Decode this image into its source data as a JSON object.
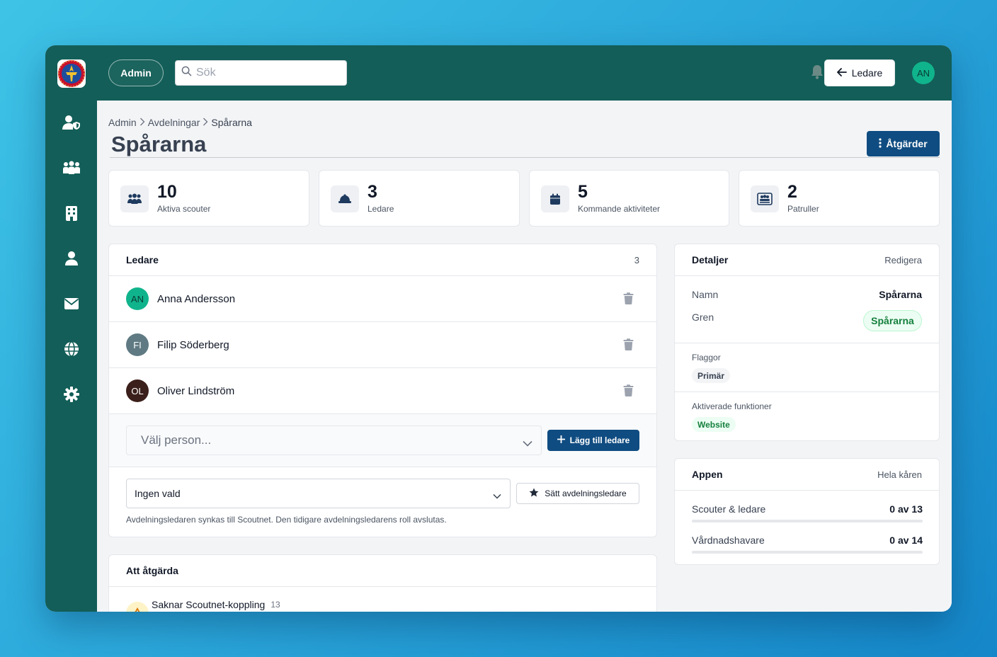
{
  "topbar": {
    "admin_label": "Admin",
    "search_placeholder": "Sök",
    "ledare_button": "Ledare",
    "user_initials": "AN"
  },
  "sidebar": {
    "items": [
      {
        "icon": "user-shield-icon"
      },
      {
        "icon": "people-group-icon"
      },
      {
        "icon": "building-icon"
      },
      {
        "icon": "user-icon"
      },
      {
        "icon": "envelope-icon"
      },
      {
        "icon": "globe-icon"
      },
      {
        "icon": "gear-icon"
      }
    ]
  },
  "breadcrumb": [
    "Admin",
    "Avdelningar",
    "Spårarna"
  ],
  "page": {
    "title": "Spårarna",
    "actions_button": "Åtgärder"
  },
  "stats": [
    {
      "value": "10",
      "label": "Aktiva scouter",
      "icon": "people-icon"
    },
    {
      "value": "3",
      "label": "Ledare",
      "icon": "hardhat-icon"
    },
    {
      "value": "5",
      "label": "Kommande aktiviteter",
      "icon": "calendar-icon"
    },
    {
      "value": "2",
      "label": "Patruller",
      "icon": "patrol-group-icon"
    }
  ],
  "leaders_card": {
    "title": "Ledare",
    "count": "3",
    "leaders": [
      {
        "initials": "AN",
        "name": "Anna Andersson",
        "color": "#10b48c"
      },
      {
        "initials": "FI",
        "name": "Filip Söderberg",
        "color": "#5f7a83"
      },
      {
        "initials": "OL",
        "name": "Oliver Lindström",
        "color": "#3b1f1a"
      }
    ],
    "person_select_placeholder": "Välj person...",
    "add_button": "Lägg till ledare",
    "section_leader_select": "Ingen vald",
    "set_section_leader_button": "Sätt avdelningsledare",
    "sync_note": "Avdelningsledaren synkas till Scoutnet. Den tidigare avdelningsledarens roll avslutas."
  },
  "todo_card": {
    "title": "Att åtgärda",
    "items": [
      {
        "label": "Saknar Scoutnet-koppling",
        "count": "13"
      }
    ]
  },
  "details_card": {
    "title": "Detaljer",
    "edit_link": "Redigera",
    "name_key": "Namn",
    "name_value": "Spårarna",
    "branch_key": "Gren",
    "branch_value": "Spårarna",
    "flags_label": "Flaggor",
    "flag": "Primär",
    "features_label": "Aktiverade funktioner",
    "feature": "Website"
  },
  "app_card": {
    "title": "Appen",
    "scope_link": "Hela kåren",
    "rows": [
      {
        "label": "Scouter & ledare",
        "value": "0 av 13",
        "progress": 0
      },
      {
        "label": "Vårdnadshavare",
        "value": "0 av 14",
        "progress": 0
      }
    ]
  },
  "colors": {
    "brand": "#135e58",
    "primary_button": "#0f4c81",
    "accent_green": "#10b48c"
  }
}
